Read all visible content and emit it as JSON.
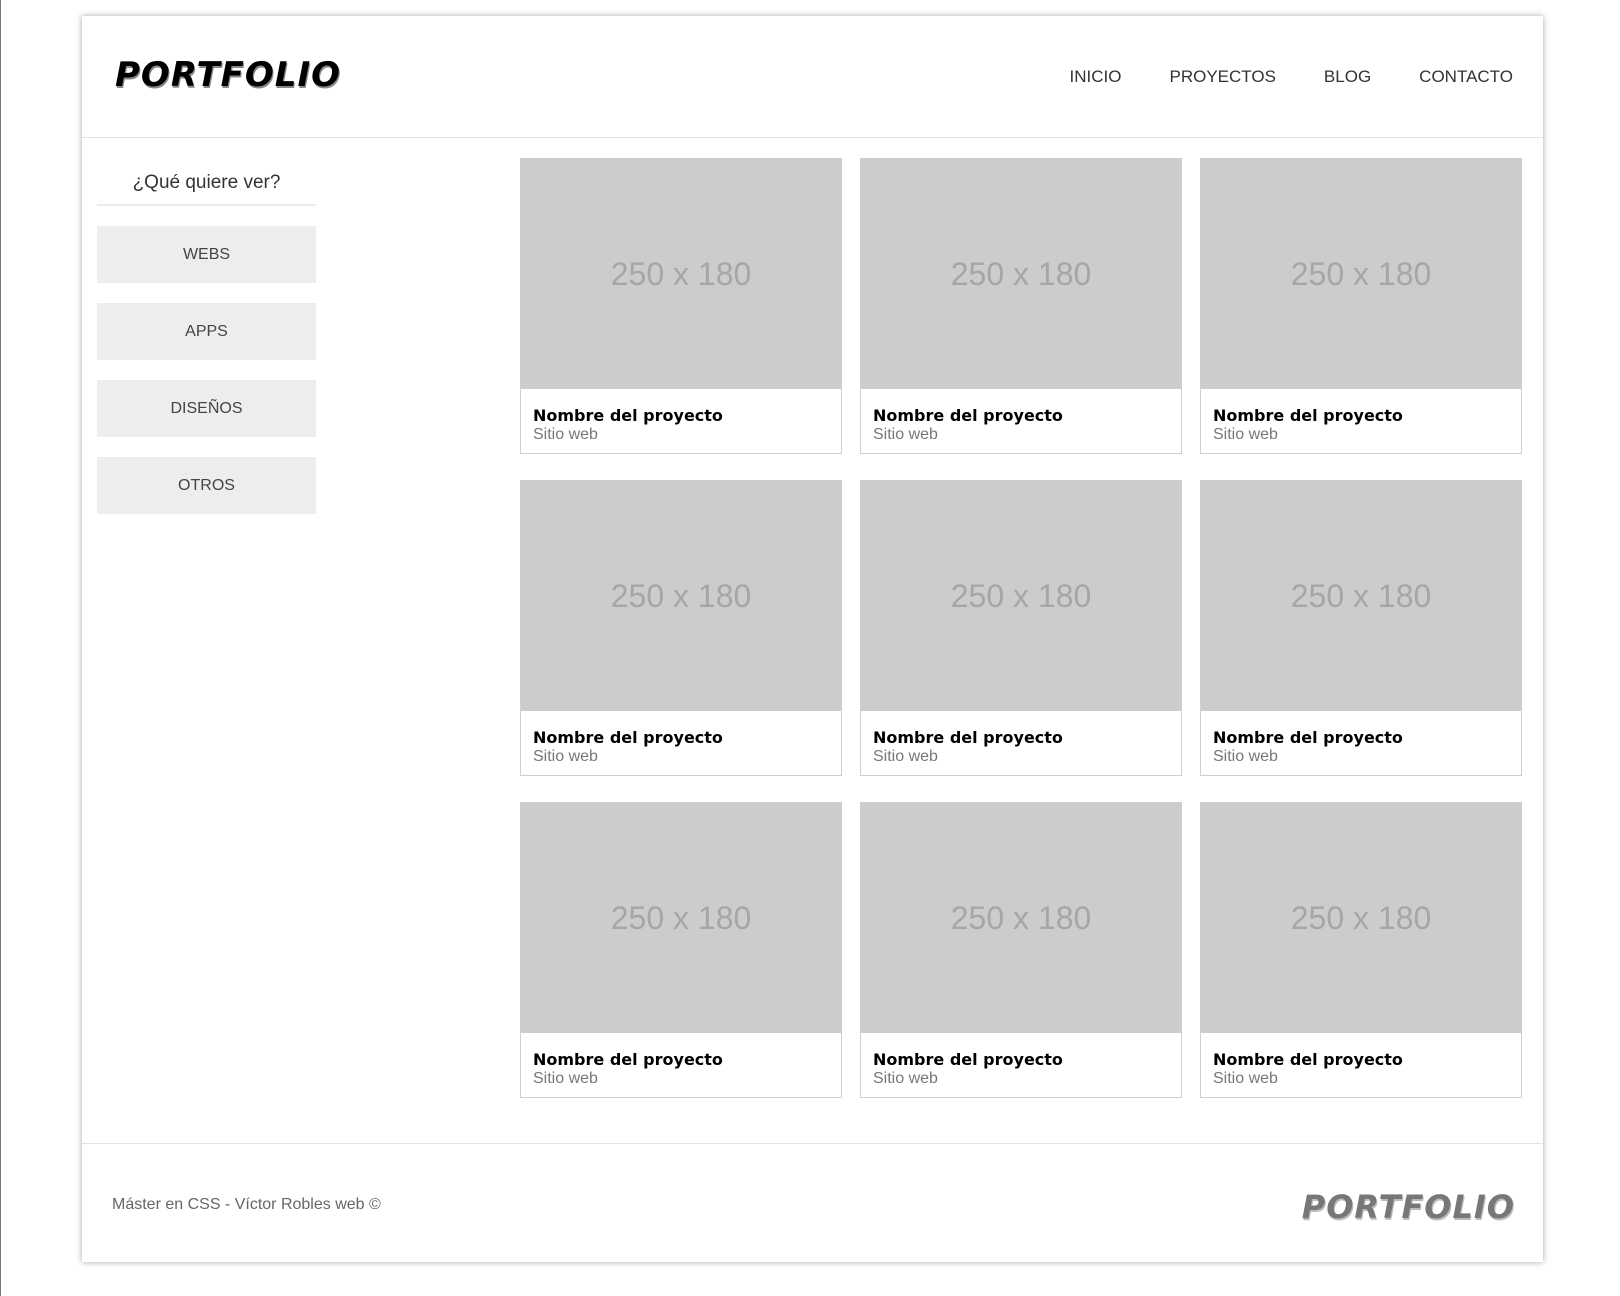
{
  "header": {
    "logo": "PORTFOLIO",
    "nav": [
      "INICIO",
      "PROYECTOS",
      "BLOG",
      "CONTACTO"
    ]
  },
  "sidebar": {
    "title": "¿Qué quiere ver?",
    "filters": [
      "WEBS",
      "APPS",
      "DISEÑOS",
      "OTROS"
    ]
  },
  "projects": [
    {
      "image_label": "250 x 180",
      "title": "Nombre del proyecto",
      "category": "Sitio web"
    },
    {
      "image_label": "250 x 180",
      "title": "Nombre del proyecto",
      "category": "Sitio web"
    },
    {
      "image_label": "250 x 180",
      "title": "Nombre del proyecto",
      "category": "Sitio web"
    },
    {
      "image_label": "250 x 180",
      "title": "Nombre del proyecto",
      "category": "Sitio web"
    },
    {
      "image_label": "250 x 180",
      "title": "Nombre del proyecto",
      "category": "Sitio web"
    },
    {
      "image_label": "250 x 180",
      "title": "Nombre del proyecto",
      "category": "Sitio web"
    },
    {
      "image_label": "250 x 180",
      "title": "Nombre del proyecto",
      "category": "Sitio web"
    },
    {
      "image_label": "250 x 180",
      "title": "Nombre del proyecto",
      "category": "Sitio web"
    },
    {
      "image_label": "250 x 180",
      "title": "Nombre del proyecto",
      "category": "Sitio web"
    }
  ],
  "footer": {
    "credit": "Máster en CSS - Víctor Robles web ©",
    "logo": "PORTFOLIO"
  }
}
